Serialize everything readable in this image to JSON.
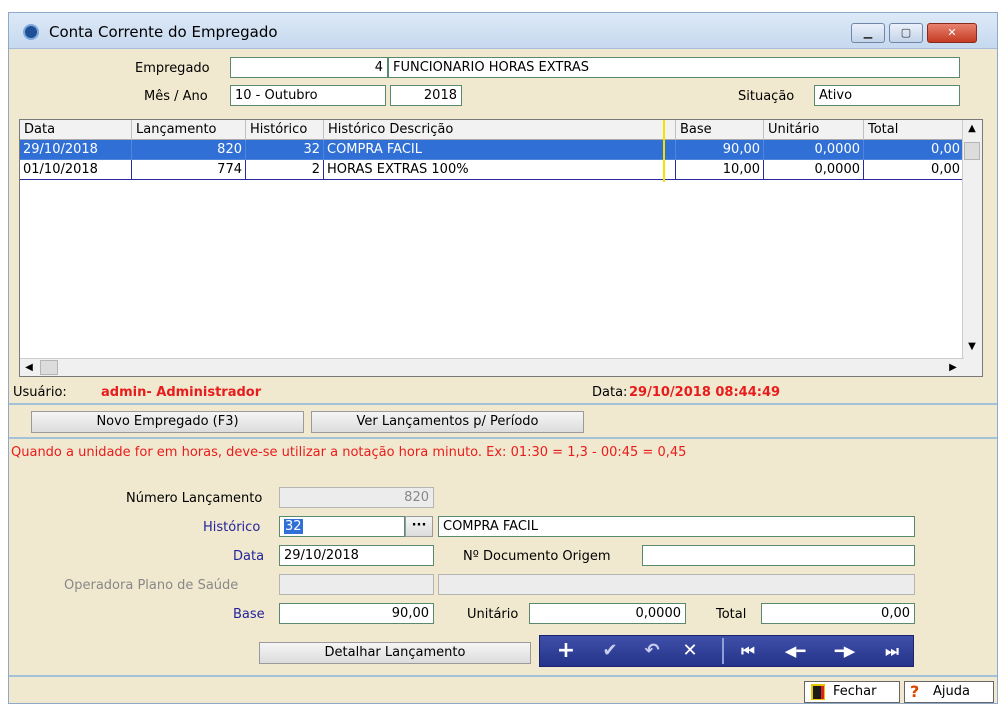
{
  "window": {
    "title": "Conta Corrente do Empregado",
    "minimize": "▁",
    "maximize": "▢",
    "close": "✕"
  },
  "header": {
    "empregado_label": "Empregado",
    "empregado_code": "4",
    "empregado_name": "FUNCIONARIO HORAS EXTRAS",
    "mes_ano_label": "Mês / Ano",
    "mes_value": "10 - Outubro",
    "ano_value": "2018",
    "situacao_label": "Situação",
    "situacao_value": "Ativo"
  },
  "grid": {
    "columns": [
      "Data",
      "Lançamento",
      "Histórico",
      "Histórico Descrição",
      "Base",
      "Unitário",
      "Total"
    ],
    "rows": [
      {
        "data": "29/10/2018",
        "lancamento": "820",
        "historico": "32",
        "descricao": "COMPRA FACIL",
        "base": "90,00",
        "unitario": "0,0000",
        "total": "0,00",
        "selected": true
      },
      {
        "data": "01/10/2018",
        "lancamento": "774",
        "historico": "2",
        "descricao": "HORAS EXTRAS 100%",
        "base": "10,00",
        "unitario": "0,0000",
        "total": "0,00",
        "selected": false
      }
    ]
  },
  "status": {
    "usuario_label": "Usuário:",
    "usuario_value": "admin- Administrador",
    "data_label": "Data:",
    "data_value": "29/10/2018 08:44:49"
  },
  "buttons": {
    "novo_empregado": "Novo Empregado (F3)",
    "ver_lancamentos": "Ver Lançamentos p/ Período",
    "detalhar": "Detalhar Lançamento",
    "fechar": "Fechar",
    "ajuda": "Ajuda"
  },
  "notice": "Quando a unidade for em horas, deve-se utilizar a notação hora minuto. Ex: 01:30 = 1,3 - 00:45 = 0,45",
  "form": {
    "numero_label": "Número Lançamento",
    "numero_value": "820",
    "historico_label": "Histórico",
    "historico_value": "32",
    "historico_desc": "COMPRA FACIL",
    "lookup_btn": "···",
    "data_label": "Data",
    "data_value": "29/10/2018",
    "documento_label": "Nº Documento Origem",
    "documento_value": "",
    "operadora_label": "Operadora Plano de Saúde",
    "operadora_value": "",
    "operadora_desc": "",
    "base_label": "Base",
    "base_value": "90,00",
    "unitario_label": "Unitário",
    "unitario_value": "0,0000",
    "total_label": "Total",
    "total_value": "0,00"
  },
  "nav": {
    "add": "+",
    "confirm": "✔",
    "undo": "↶",
    "cancel": "✕",
    "first": "⏮",
    "prev": "◀━",
    "next": "━▶",
    "last": "⏭"
  },
  "colors": {
    "window_bg": "#f1e9cf",
    "selection": "#2f6fd6",
    "status_red": "#e81c1c",
    "nav_blue": "#25338a"
  }
}
